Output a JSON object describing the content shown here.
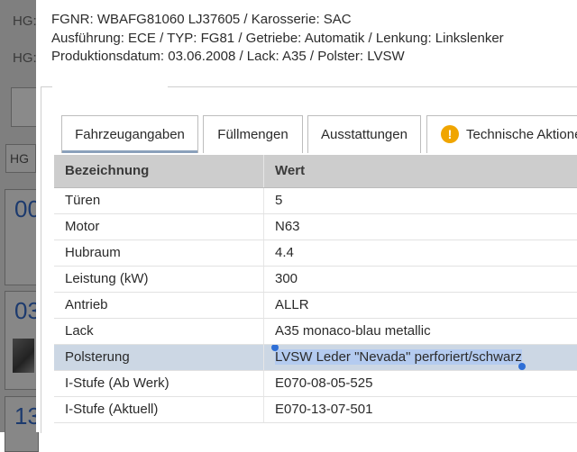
{
  "background": {
    "hg_labels": [
      "HG:",
      "HG:"
    ],
    "hg_small": "HG",
    "card_numbers": [
      "00",
      "03",
      "13"
    ]
  },
  "header": {
    "line1": "FGNR: WBAFG81060 LJ37605 / Karosserie: SAC",
    "line2": "Ausführung: ECE / TYP: FG81 / Getriebe: Automatik / Lenkung: Linkslenker",
    "line3": "Produktionsdatum: 03.06.2008 / Lack: A35 / Polster: LVSW"
  },
  "tabs": [
    {
      "label": "Fahrzeugangaben",
      "active": true
    },
    {
      "label": "Füllmengen",
      "active": false
    },
    {
      "label": "Ausstattungen",
      "active": false
    },
    {
      "label": "Technische Aktione",
      "active": false,
      "icon": "warning-icon",
      "icon_glyph": "!"
    }
  ],
  "table": {
    "headers": [
      "Bezeichnung",
      "Wert"
    ],
    "rows": [
      [
        "Türen",
        "5"
      ],
      [
        "Motor",
        "N63"
      ],
      [
        "Hubraum",
        "4.4"
      ],
      [
        "Leistung (kW)",
        "300"
      ],
      [
        "Antrieb",
        "ALLR"
      ],
      [
        "Lack",
        "A35 monaco-blau metallic"
      ],
      [
        "Polsterung",
        "LVSW Leder \"Nevada\" perforiert/schwarz"
      ],
      [
        "I-Stufe (Ab Werk)",
        "E070-08-05-525"
      ],
      [
        "I-Stufe (Aktuell)",
        "E070-13-07-501"
      ]
    ],
    "selected_row": 6
  },
  "colors": {
    "overlay": "#7f7f7f",
    "table_header": "#cdcdcd",
    "selected_row": "#ccd7e4",
    "text_selection": "#b4cbf0",
    "selection_handle": "#2f6fd6",
    "warning": "#f0a500",
    "card_number": "#1c3a6e"
  }
}
